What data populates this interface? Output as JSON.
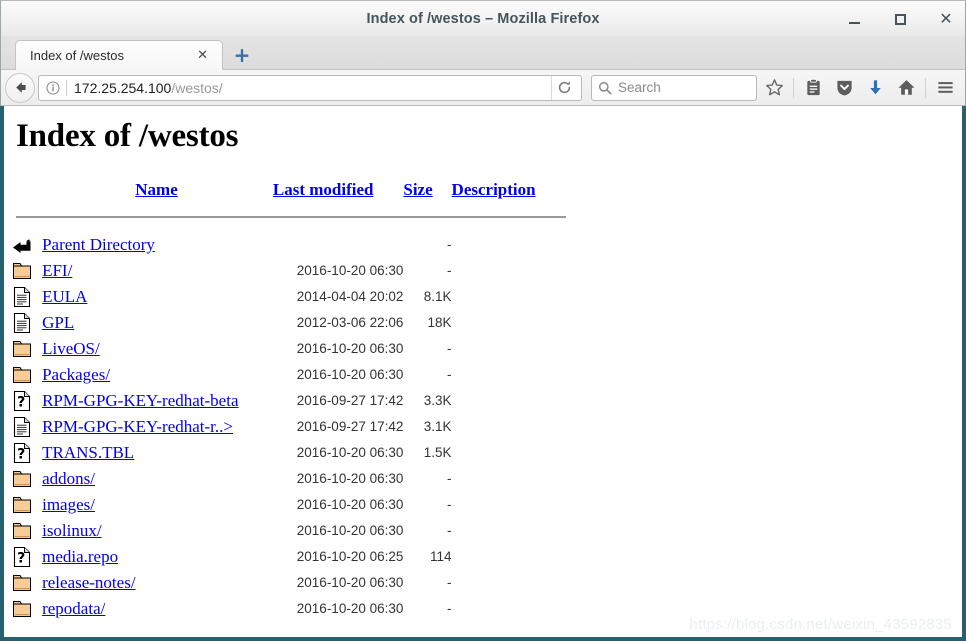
{
  "window": {
    "title": "Index of /westos – Mozilla Firefox",
    "minimize_label": "Minimize",
    "maximize_label": "Maximize",
    "close_label": "✕"
  },
  "tabs": [
    {
      "label": "Index of /westos",
      "close": "✕",
      "active": true
    }
  ],
  "newtab_label": "+",
  "toolbar": {
    "back_icon": "back-arrow-icon",
    "identity_icon": "info-icon",
    "url_host": "172.25.254.100",
    "url_path": "/westos/",
    "reload_icon": "reload-icon",
    "search_placeholder": "Search",
    "search_icon": "search-icon",
    "bookmark_icon": "star-icon",
    "library_icon": "library-icon",
    "pocket_icon": "pocket-icon",
    "downloads_icon": "download-icon",
    "home_icon": "home-icon",
    "menu_icon": "hamburger-menu-icon"
  },
  "page": {
    "heading": "Index of /westos",
    "columns": {
      "name": "Name",
      "last_modified": "Last modified",
      "size": "Size",
      "description": "Description"
    },
    "rows": [
      {
        "icon": "parent-directory-icon",
        "name": "Parent Directory",
        "date": "",
        "size": "-",
        "description": ""
      },
      {
        "icon": "folder-icon",
        "name": "EFI/",
        "date": "2016-10-20 06:30",
        "size": "-",
        "description": ""
      },
      {
        "icon": "text-file-icon",
        "name": "EULA",
        "date": "2014-04-04 20:02",
        "size": "8.1K",
        "description": ""
      },
      {
        "icon": "text-file-icon",
        "name": "GPL",
        "date": "2012-03-06 22:06",
        "size": "18K",
        "description": ""
      },
      {
        "icon": "folder-icon",
        "name": "LiveOS/",
        "date": "2016-10-20 06:30",
        "size": "-",
        "description": ""
      },
      {
        "icon": "folder-icon",
        "name": "Packages/",
        "date": "2016-10-20 06:30",
        "size": "-",
        "description": ""
      },
      {
        "icon": "unknown-file-icon",
        "name": "RPM-GPG-KEY-redhat-beta",
        "date": "2016-09-27 17:42",
        "size": "3.3K",
        "description": ""
      },
      {
        "icon": "text-file-icon",
        "name": "RPM-GPG-KEY-redhat-r..>",
        "date": "2016-09-27 17:42",
        "size": "3.1K",
        "description": ""
      },
      {
        "icon": "unknown-file-icon",
        "name": "TRANS.TBL",
        "date": "2016-10-20 06:30",
        "size": "1.5K",
        "description": ""
      },
      {
        "icon": "folder-icon",
        "name": "addons/",
        "date": "2016-10-20 06:30",
        "size": "-",
        "description": ""
      },
      {
        "icon": "folder-icon",
        "name": "images/",
        "date": "2016-10-20 06:30",
        "size": "-",
        "description": ""
      },
      {
        "icon": "folder-icon",
        "name": "isolinux/",
        "date": "2016-10-20 06:30",
        "size": "-",
        "description": ""
      },
      {
        "icon": "unknown-file-icon",
        "name": "media.repo",
        "date": "2016-10-20 06:25",
        "size": "114",
        "description": ""
      },
      {
        "icon": "folder-icon",
        "name": "release-notes/",
        "date": "2016-10-20 06:30",
        "size": "-",
        "description": ""
      },
      {
        "icon": "folder-icon",
        "name": "repodata/",
        "date": "2016-10-20 06:30",
        "size": "-",
        "description": ""
      }
    ]
  },
  "watermark": "https://blog.csdn.net/weixin_43592835",
  "colors": {
    "link": "#0000ee",
    "window_border": "#27616f",
    "title_text": "#44555e",
    "folder_fill": "#f5c98f"
  }
}
